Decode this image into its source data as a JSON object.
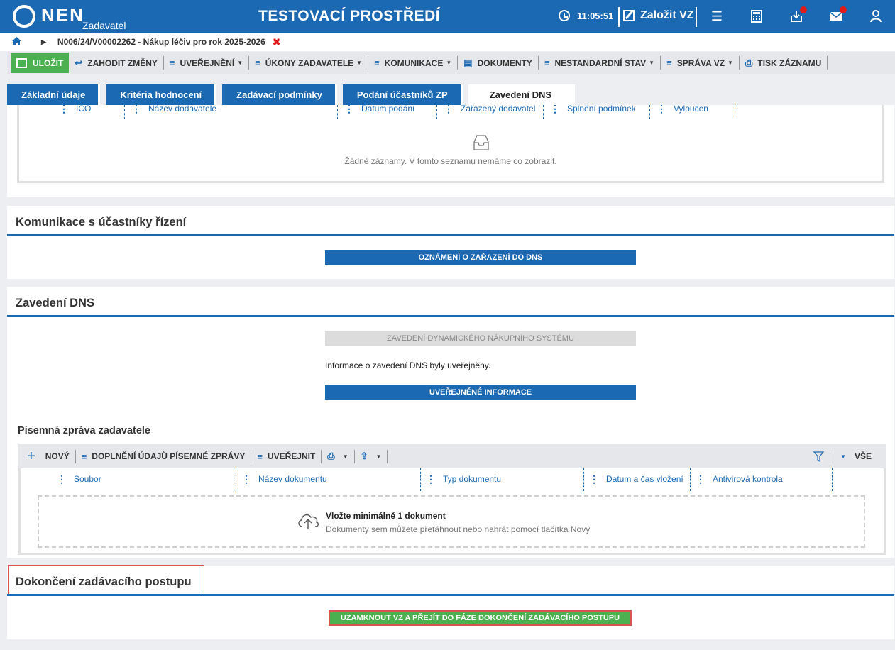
{
  "header": {
    "logo_text": "NEN",
    "logo_sub": "Zadavatel",
    "env_title": "TESTOVACÍ PROSTŘEDÍ",
    "clock": "11:05:51",
    "create_label": "Založit VZ"
  },
  "breadcrumb": {
    "path": "N006/24/V00002262 - Nákup léčiv pro rok 2025-2026",
    "close": "✖"
  },
  "toolbar": {
    "save": "ULOŽIT",
    "discard": "ZAHODIT ZMĚNY",
    "publish": "UVEŘEJNĚNÍ",
    "acts": "ÚKONY ZADAVATELE",
    "comm": "KOMUNIKACE",
    "docs": "DOKUMENTY",
    "nonstandard": "NESTANDARDNÍ STAV",
    "manage": "SPRÁVA VZ",
    "print": "TISK ZÁZNAMU"
  },
  "tabs": [
    "Základní údaje",
    "Kritéria hodnocení",
    "Zadávací podmínky",
    "Podání účastníků ZP",
    "Zavedení DNS"
  ],
  "top_table": {
    "columns": [
      "IČO",
      "Název dodavatele",
      "Datum podání",
      "Zařazený dodavatel",
      "Splnění podmínek",
      "Vyloučen"
    ],
    "empty_text": "Žádné záznamy. V tomto seznamu nemáme co zobrazit."
  },
  "communication": {
    "title": "Komunikace s účastníky řízení",
    "button": "OZNÁMENÍ O ZAŘAZENÍ DO DNS"
  },
  "dns": {
    "title": "Zavedení DNS",
    "disabled_button": "ZAVEDENÍ DYNAMICKÉHO NÁKUPNÍHO SYSTÉMU",
    "info": "Informace o zavedení DNS byly uveřejněny.",
    "published_button": "UVEŘEJNĚNÉ INFORMACE"
  },
  "report": {
    "title": "Písemná zpráva zadavatele",
    "new": "NOVÝ",
    "fill": "DOPLNĚNÍ ÚDAJŮ PÍSEMNÉ ZPRÁVY",
    "publish": "UVEŘEJNIT",
    "all": "VŠE",
    "columns": [
      "Soubor",
      "Název dokumentu",
      "Typ dokumentu",
      "Datum a čas vložení",
      "Antivirová kontrola"
    ],
    "drop_title": "Vložte minimálně 1 dokument",
    "drop_text": "Dokumenty sem můžete přetáhnout nebo nahrát pomocí tlačítka Nový"
  },
  "completion": {
    "title": "Dokončení zadávacího postupu",
    "button": "UZAMKNOUT VZ A PŘEJÍT DO FÁZE DOKONČENÍ ZADÁVACÍHO POSTUPU"
  },
  "colors": {
    "primary": "#1b69b3",
    "green": "#4caf50",
    "alert": "#e01919"
  }
}
